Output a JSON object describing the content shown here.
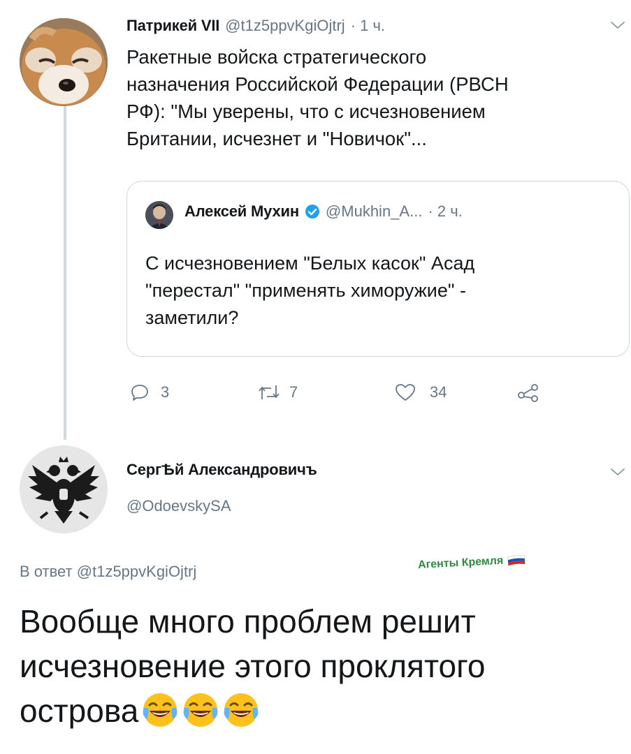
{
  "tweet1": {
    "author_name": "Патрикей VII",
    "handle": "@t1z5ppvKgiOjtrj",
    "time": "· 1 ч.",
    "text_lines": [
      "Ракетные войска стратегического",
      "назначения Российской Федерации (РВСН",
      "РФ): \"Мы уверены, что с исчезновением",
      "Британии, исчезнет и \"Новичок\"..."
    ],
    "quote": {
      "author_name": "Алексей Мухин",
      "handle": "@Mukhin_A...",
      "time": "· 2 ч.",
      "text_lines": [
        "С исчезновением \"Белых касок\" Асад",
        "\"перестал\" \"применять химоружие\" -",
        "заметили?"
      ]
    },
    "actions": {
      "reply_count": "3",
      "retweet_count": "7",
      "like_count": "34"
    }
  },
  "tweet2": {
    "author_name": "СергѢй Александровичъ",
    "handle": "@OdoevskySA",
    "reply_prefix": "В ответ",
    "reply_to": "@t1z5ppvKgiOjtrj",
    "text_lines": [
      "Вообще много проблем решит",
      "исчезновение этого проклятого",
      "острова"
    ],
    "emoji": [
      "face-with-tears-of-joy",
      "face-with-tears-of-joy",
      "face-with-tears-of-joy"
    ]
  },
  "watermark": {
    "text": "Агенты Кремля"
  },
  "colors": {
    "text": "#14171a",
    "secondary": "#657786",
    "verified": "#1da1f2",
    "watermark": "#2e8a3c",
    "border": "#ccd6dd"
  }
}
